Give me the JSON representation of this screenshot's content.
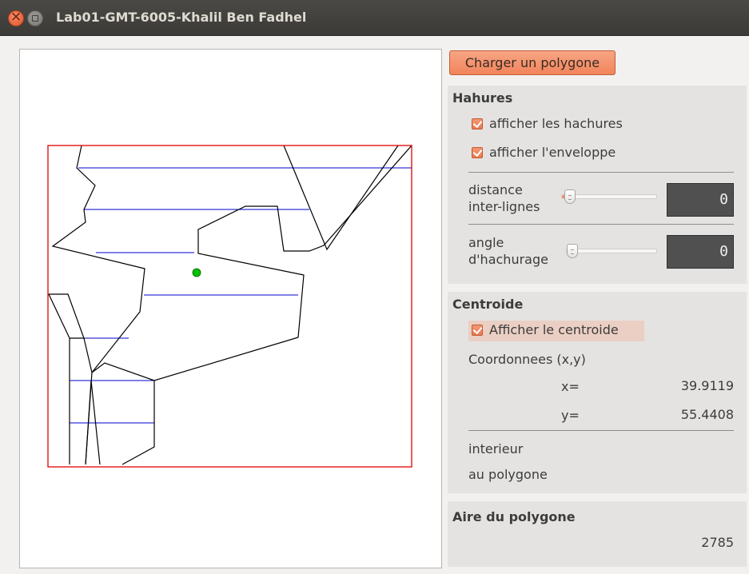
{
  "window": {
    "title": "Lab01-GMT-6005-Khalil Ben Fadhel"
  },
  "toolbar": {
    "load_label": "Charger un polygone"
  },
  "hatches": {
    "title": "Hahures",
    "show_hatches_label": "afficher les hachures",
    "show_hatches_checked": true,
    "show_envelope_label": "afficher l'enveloppe",
    "show_envelope_checked": true,
    "distance_label_line1": "distance",
    "distance_label_line2": "inter-lignes",
    "distance_display": "0",
    "angle_label_line1": "angle",
    "angle_label_line2": "d'hachurage",
    "angle_display": "0"
  },
  "centroid": {
    "title": "Centroide",
    "show_label": "Afficher le centroide",
    "show_checked": true,
    "coords_label": "Coordonnees (x,y)",
    "x_label": "x=",
    "x_value": "39.9119",
    "y_label": "y=",
    "y_value": "55.4408",
    "status_line1": "interieur",
    "status_line2": "au polygone"
  },
  "area": {
    "title": "Aire du polygone",
    "value": "2785"
  },
  "colors": {
    "accent": "#f1845b",
    "envelope": "#e00000",
    "hatch": "#0000cc",
    "centroid": "#00c000"
  }
}
